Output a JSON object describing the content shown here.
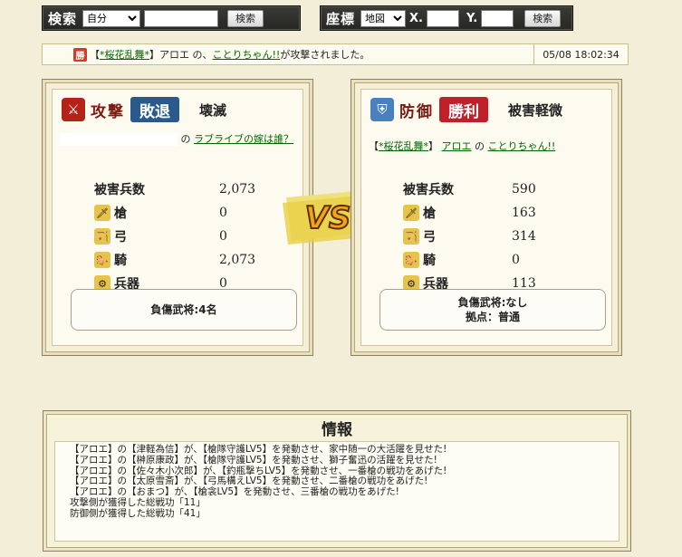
{
  "search_bar": {
    "label": "検索",
    "select_value": "自分",
    "input_value": "",
    "button": "検索"
  },
  "coord_bar": {
    "label": "座標",
    "select_value": "地図",
    "x_label": "X.",
    "y_label": "Y.",
    "x_value": "",
    "y_value": "",
    "button": "検索"
  },
  "notice": {
    "badge": "勝",
    "prefix": "【",
    "alliance": "*桜花乱舞*",
    "mid1": "】アロエ の、",
    "target": "ことりちゃん!!",
    "suffix": "が攻撃されました。",
    "time": "05/08 18:02:34"
  },
  "attacker": {
    "kind": "攻撃",
    "result": "敗退",
    "status": "壊滅",
    "owner_name": "",
    "owner_of": "の",
    "owner_base": "ラブライブの嫁は誰？",
    "damage_label": "被害兵数",
    "damage": "2,073",
    "units": [
      {
        "name": "槍",
        "value": "0"
      },
      {
        "name": "弓",
        "value": "0"
      },
      {
        "name": "騎",
        "value": "2,073"
      },
      {
        "name": "兵器",
        "value": "0"
      }
    ],
    "summary1": "負傷武将:4名",
    "summary2": ""
  },
  "defender": {
    "kind": "防御",
    "result": "勝利",
    "status": "被害軽微",
    "owner_prefix": "【",
    "owner_alliance": "*桜花乱舞*",
    "owner_mid": "】",
    "owner_name": "アロエ",
    "owner_of": "の",
    "owner_base": "ことりちゃん!!",
    "damage_label": "被害兵数",
    "damage": "590",
    "units": [
      {
        "name": "槍",
        "value": "163"
      },
      {
        "name": "弓",
        "value": "314"
      },
      {
        "name": "騎",
        "value": "0"
      },
      {
        "name": "兵器",
        "value": "113"
      }
    ],
    "summary1": "負傷武将:なし",
    "summary2": "拠点：普通"
  },
  "vs_text": "VS",
  "info": {
    "title": "情報",
    "lines": [
      "【アロエ】の【津軽為信】が、【槍隊守護LV5】を発動させ、家中随一の大活躍を見せた!",
      "【アロエ】の【榊原康政】が、【槍隊守護LV5】を発動させ、獅子奮迅の活躍を見せた!",
      "【アロエ】の【佐々木小次郎】が、【釣瓶撃ちLV5】を発動させ、一番槍の戦功をあげた!",
      "【アロエ】の【太原雪斎】が、【弓馬構えLV5】を発動させ、二番槍の戦功をあげた!",
      "【アロエ】の【おまつ】が、【槍衾LV5】を発動させ、三番槍の戦功をあげた!",
      "攻撃側が獲得した総戦功「11」",
      "防御側が獲得した総戦功「41」"
    ]
  },
  "colors": {
    "attack_result": "#2a5a8c",
    "defend_result": "#c0202a",
    "bar_bg": "#2e2e2a",
    "link": "#006600"
  },
  "icons": {
    "attack": "crossed-swords-icon",
    "defend": "shield-icon",
    "spear": "spear-icon",
    "bow": "bow-icon",
    "cavalry": "horse-icon",
    "siege": "siege-icon"
  }
}
